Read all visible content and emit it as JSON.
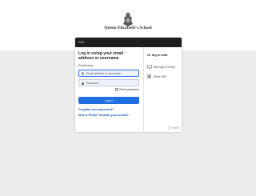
{
  "header": {
    "school_name": "Queen Elizabeth's School",
    "crest_icon": "school-crest-icon"
  },
  "card": {
    "language_indicator": "ENG",
    "title": "Log in using your email address or username",
    "field_label": "Email/name",
    "email_placeholder": "Email address or username",
    "password_placeholder": "Password",
    "show_password_label": "Show password",
    "login_button": "Log in",
    "forgot_password": "Forgotten your password?",
    "new_to_firefly": "New to Firefly? Activate your account",
    "or_login_with": "Or log in with",
    "sso_options": [
      {
        "label": "Site login (Firefly)",
        "icon": "site-login-icon"
      },
      {
        "label": "Office 365",
        "icon": "office-365-icon"
      }
    ],
    "brand": "firefly"
  },
  "colors": {
    "primary": "#1f6fe0",
    "header_bar": "#1e1e1e",
    "page_background": "#ececec"
  }
}
